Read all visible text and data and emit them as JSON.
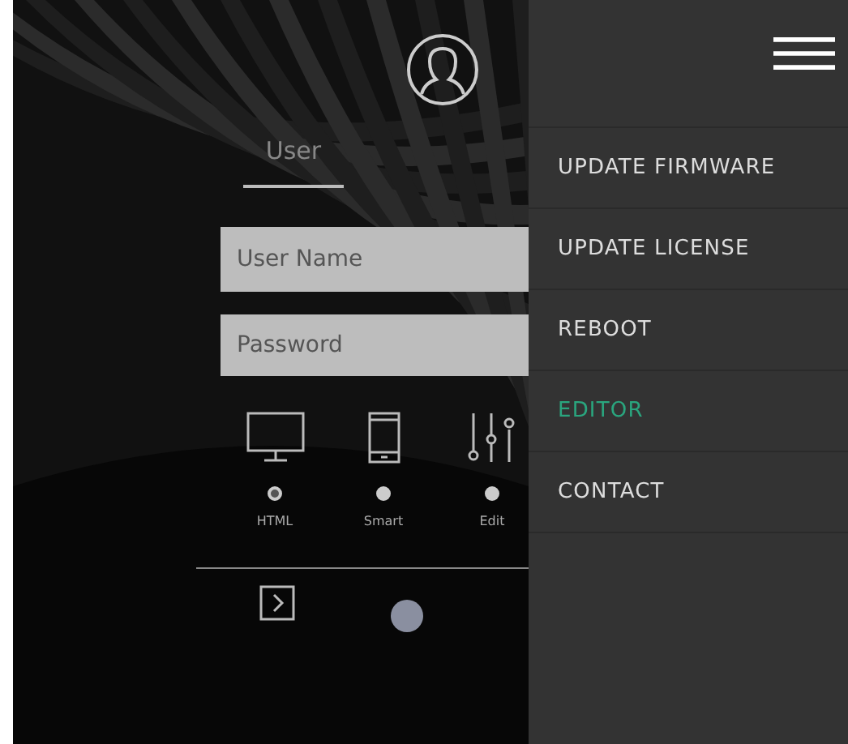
{
  "login": {
    "tab": {
      "label": "User",
      "selected": true
    },
    "fields": [
      {
        "placeholder": "User Name"
      },
      {
        "placeholder": "Password"
      }
    ],
    "modes": [
      {
        "kind": "monitor",
        "label": "HTML",
        "selected": true
      },
      {
        "kind": "phone",
        "label": "Smart",
        "selected": false
      },
      {
        "kind": "sliders",
        "label": "Edit",
        "selected": false
      }
    ]
  },
  "menu": {
    "items": [
      {
        "label": "UPDATE FIRMWARE",
        "selected": false
      },
      {
        "label": "UPDATE LICENSE",
        "selected": false
      },
      {
        "label": "REBOOT",
        "selected": false
      },
      {
        "label": "EDITOR",
        "selected": true
      },
      {
        "label": "CONTACT",
        "selected": false
      }
    ]
  }
}
